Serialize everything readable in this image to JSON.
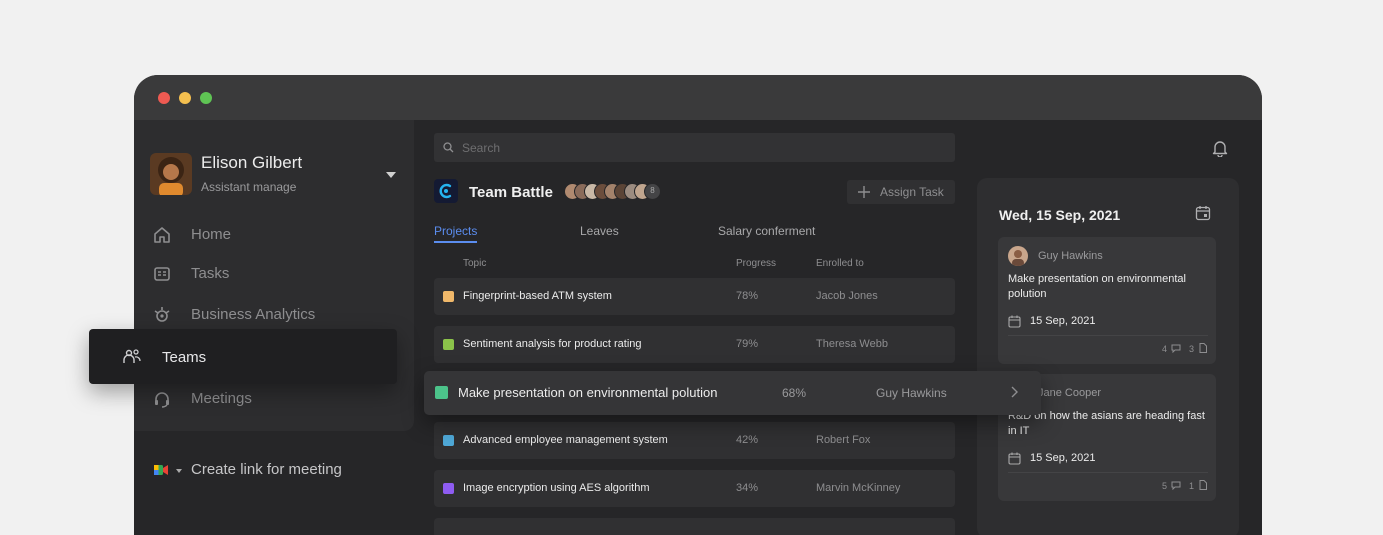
{
  "user": {
    "name": "Elison Gilbert",
    "role": "Assistant manage"
  },
  "nav": [
    {
      "label": "Home",
      "icon": "home-icon"
    },
    {
      "label": "Tasks",
      "icon": "tasks-icon"
    },
    {
      "label": "Business Analytics",
      "icon": "analytics-icon"
    },
    {
      "label": "Teams",
      "icon": "teams-icon"
    },
    {
      "label": "Meetings",
      "icon": "headset-icon"
    }
  ],
  "create_link": {
    "label": "Create link for meeting"
  },
  "search": {
    "placeholder": "Search"
  },
  "team": {
    "name": "Team Battle",
    "assign_label": "Assign Task",
    "extra_count": "8"
  },
  "tabs": [
    {
      "label": "Projects"
    },
    {
      "label": "Leaves"
    },
    {
      "label": "Salary conferment"
    }
  ],
  "columns": {
    "topic": "Topic",
    "progress": "Progress",
    "enrolled": "Enrolled to"
  },
  "projects": [
    {
      "topic": "Fingerprint-based ATM system",
      "progress": "78%",
      "enrolled": "Jacob Jones",
      "color": "#f0b86a"
    },
    {
      "topic": "Sentiment analysis for product rating",
      "progress": "79%",
      "enrolled": "Theresa Webb",
      "color": "#8bc34a"
    },
    {
      "topic": "Make presentation on environmental polution",
      "progress": "68%",
      "enrolled": "Guy Hawkins",
      "color": "#4cc38a"
    },
    {
      "topic": "Advanced employee management system",
      "progress": "42%",
      "enrolled": "Robert Fox",
      "color": "#4fa9d8"
    },
    {
      "topic": "Image encryption using AES algorithm",
      "progress": "34%",
      "enrolled": "Marvin McKinney",
      "color": "#8e5cf2"
    }
  ],
  "calendar": {
    "date": "Wed, 15 Sep, 2021",
    "cards": [
      {
        "name": "Guy Hawkins",
        "title": "Make presentation on environmental polution",
        "date": "15 Sep, 2021",
        "comments": "4",
        "files": "3"
      },
      {
        "name": "Jane Cooper",
        "title": "R&D on how the asians are heading fast in IT",
        "date": "15 Sep, 2021",
        "comments": "5",
        "files": "1"
      }
    ]
  }
}
